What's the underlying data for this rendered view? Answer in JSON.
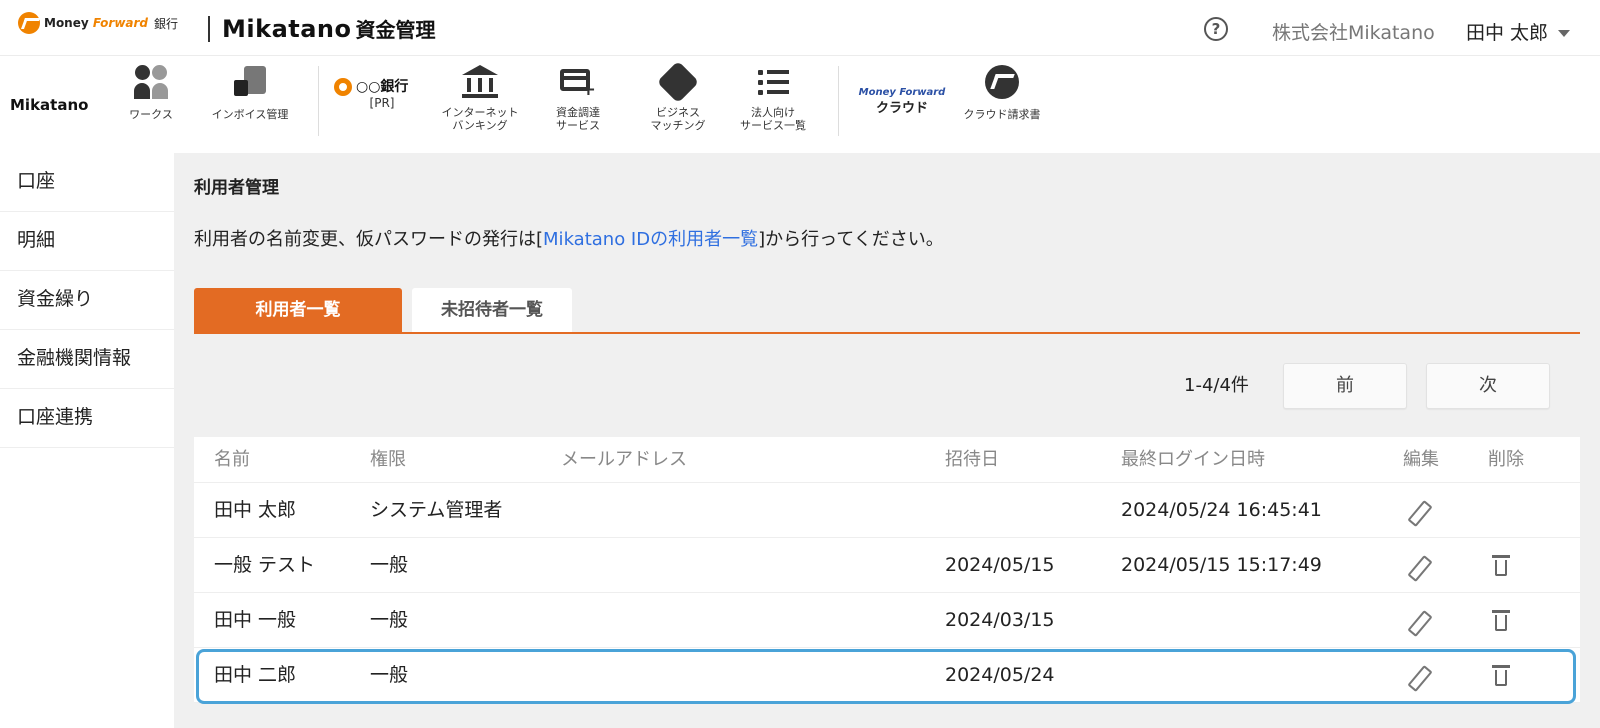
{
  "header": {
    "mf_brand": "Money",
    "mf_brand_accent": "Forward",
    "mf_bank": "銀行",
    "app_name": "Mikatano",
    "app_sub": "資金管理",
    "help_glyph": "?",
    "company": "株式会社Mikatano",
    "user": "田中 太郎"
  },
  "service_bar": {
    "logo": "Mikatano",
    "items": [
      {
        "label": "ワークス",
        "icon": "works-icon"
      },
      {
        "label": "インボイス管理",
        "icon": "invoice-icon"
      },
      {
        "label": "○○銀行",
        "sub": "[PR]",
        "icon": "bank-ring-icon"
      },
      {
        "label": "インターネット",
        "label2": "バンキング",
        "icon": "bank-building-icon"
      },
      {
        "label": "資金調達",
        "label2": "サービス",
        "icon": "card-plus-icon"
      },
      {
        "label": "ビジネス",
        "label2": "マッチング",
        "icon": "handshake-icon"
      },
      {
        "label": "法人向け",
        "label2": "サービス一覧",
        "icon": "list-icon"
      },
      {
        "label": "Money Forward",
        "label2": "クラウド",
        "icon": "mf-cloud-logo"
      },
      {
        "label": "クラウド請求書",
        "icon": "cloud-invoice-icon"
      }
    ]
  },
  "sidebar": {
    "items": [
      "口座",
      "明細",
      "資金繰り",
      "金融機関情報",
      "口座連携"
    ]
  },
  "main": {
    "title": "利用者管理",
    "notice_prefix": "利用者の名前変更、仮パスワードの発行は[",
    "notice_link": "Mikatano IDの利用者一覧",
    "notice_suffix": "]から行ってください。",
    "tabs": [
      "利用者一覧",
      "未招待者一覧"
    ],
    "count": "1-4/4件",
    "prev": "前",
    "next": "次",
    "columns": [
      "名前",
      "権限",
      "メールアドレス",
      "招待日",
      "最終ログイン日時",
      "編集",
      "削除"
    ],
    "rows": [
      {
        "name": "田中 太郎",
        "role": "システム管理者",
        "email": "",
        "invited": "",
        "last_login": "2024/05/24 16:45:41",
        "deletable": false
      },
      {
        "name": "一般 テスト",
        "role": "一般",
        "email": "",
        "invited": "2024/05/15",
        "last_login": "2024/05/15 15:17:49",
        "deletable": true
      },
      {
        "name": "田中 一般",
        "role": "一般",
        "email": "",
        "invited": "2024/03/15",
        "last_login": "",
        "deletable": true
      },
      {
        "name": "田中 二郎",
        "role": "一般",
        "email": "",
        "invited": "2024/05/24",
        "last_login": "",
        "deletable": true
      }
    ]
  },
  "colors": {
    "accent": "#e36b23",
    "brand_orange": "#f08300",
    "link": "#2f6fe0",
    "highlight": "#4aa3d8"
  }
}
